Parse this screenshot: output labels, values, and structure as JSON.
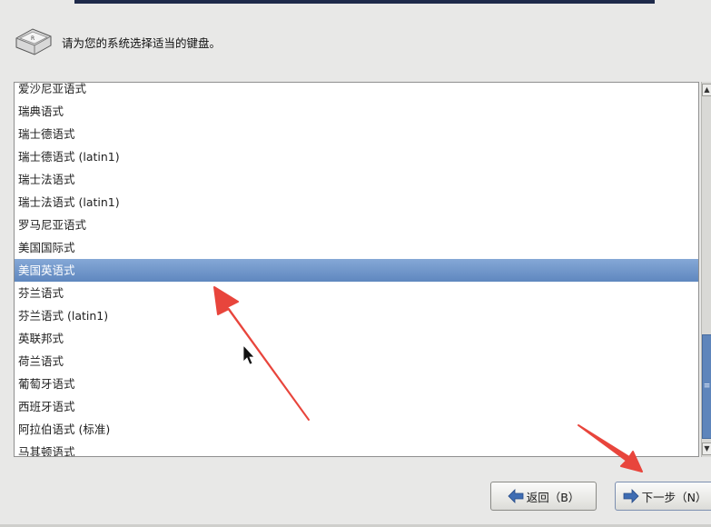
{
  "header": {
    "text": "请为您的系统选择适当的键盘。",
    "icon": "keyboard-key-icon"
  },
  "keyboard_list": {
    "items": [
      "爱沙尼亚语式",
      "瑞典语式",
      "瑞士德语式",
      "瑞士德语式 (latin1)",
      "瑞士法语式",
      "瑞士法语式 (latin1)",
      "罗马尼亚语式",
      "美国国际式",
      "美国英语式",
      "芬兰语式",
      "芬兰语式 (latin1)",
      "英联邦式",
      "荷兰语式",
      "葡萄牙语式",
      "西班牙语式",
      "阿拉伯语式 (标准)",
      "马其顿语式"
    ],
    "selected_index": 8
  },
  "buttons": {
    "back_label": "返回（B）",
    "next_label": "下一步（N）"
  },
  "colors": {
    "selection": "#6b8fc4",
    "annotation_arrow": "#e8453c",
    "top_banner": "#1e2a4a"
  }
}
